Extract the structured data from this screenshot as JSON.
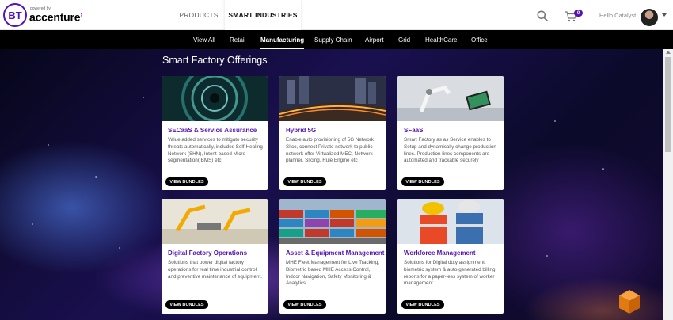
{
  "brand": {
    "logo_initials": "BT",
    "powered_by": "powered by",
    "name": "accenture"
  },
  "top_tabs": {
    "products": "PRODUCTS",
    "smart_industries": "SMART INDUSTRIES"
  },
  "header": {
    "cart_count": "0",
    "greeting": "Hello Catalyst"
  },
  "subnav": {
    "items": [
      {
        "label": "View All"
      },
      {
        "label": "Retail"
      },
      {
        "label": "Manufacturing",
        "active": true
      },
      {
        "label": "Supply Chain"
      },
      {
        "label": "Airport"
      },
      {
        "label": "Grid"
      },
      {
        "label": "HealthCare"
      },
      {
        "label": "Office"
      }
    ]
  },
  "main": {
    "title": "Smart Factory Offerings",
    "button_label": "VIEW BUNDLES",
    "cards": [
      {
        "title": "SECaaS & Service Assurance",
        "desc": "Value added services to mitigate security threats automatically, includes Self-Healing Network (SHN), Intent-based Micro-segmentation(IBMS) etc."
      },
      {
        "title": "Hybrid 5G",
        "desc": "Enable auto provisioning of 5G Network Slice, connect Private network to public network offer Virtualized MEC, Network planner, Slicing, Rule Engine etc"
      },
      {
        "title": "SFaaS",
        "desc": "Smart Factory as as Service enables to Setup and dynamically change production lines. Production lines components are automated and trackable securely"
      },
      {
        "title": "Digital Factory Operations",
        "desc": "Solutions that power digital factory operations for real time industrial control and preventive maintenance of equipment."
      },
      {
        "title": "Asset & Equipment Management",
        "desc": "MHE Fleet Management for Live Tracking, Biometric based MHE Access Control, Indoor Navigation, Safety Monitoring & Analytics."
      },
      {
        "title": "Workforce Management",
        "desc": "Solutions for Digital duty assignment, biometric system & auto-generated billing reports for a paper-less system of worker management."
      }
    ]
  },
  "colors": {
    "brand_purple": "#5514b4",
    "accenture_accent": "#a100ff",
    "nav_bg": "#000000",
    "widget_orange": "#f08a1c"
  },
  "icons": [
    "search-icon",
    "cart-icon",
    "chevron-down-icon",
    "cube-icon"
  ]
}
